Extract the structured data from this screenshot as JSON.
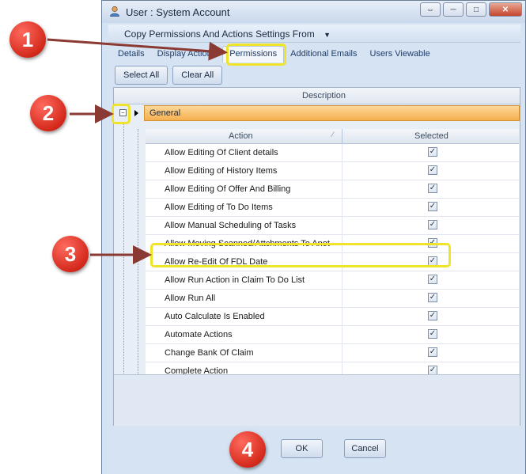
{
  "window": {
    "title": "User : System Account",
    "controls": {
      "restore": "⇔",
      "minimize": "─",
      "maximize": "□",
      "close": "✕"
    }
  },
  "copy_bar": {
    "label": "Copy Permissions And Actions Settings From",
    "icon": "chevron-down-icon"
  },
  "tabs": [
    "Details",
    "Display Actions",
    "Permissions",
    "Additional Emails",
    "Users Viewable"
  ],
  "active_tab": "Permissions",
  "buttons": {
    "select_all": "Select All",
    "clear_all": "Clear All"
  },
  "grid": {
    "header": "Description",
    "group": {
      "name": "General",
      "expander": "−"
    },
    "inner": {
      "col_action": "Action",
      "col_selected": "Selected",
      "rows": [
        {
          "label": "Allow Editing Of Client details",
          "checked": true
        },
        {
          "label": "Allow Editing of History Items",
          "checked": true
        },
        {
          "label": "Allow Editing Of Offer And Billing",
          "checked": true
        },
        {
          "label": "Allow Editing of To Do Items",
          "checked": true
        },
        {
          "label": "Allow Manual Scheduling of Tasks",
          "checked": true
        },
        {
          "label": "Allow Moving Scanned/Attchments To Anot",
          "checked": true
        },
        {
          "label": "Allow Re-Edit Of FDL Date",
          "checked": true
        },
        {
          "label": "Allow Run Action in Claim To Do List",
          "checked": true
        },
        {
          "label": "Allow Run All",
          "checked": true
        },
        {
          "label": "Auto Calculate Is Enabled",
          "checked": true
        },
        {
          "label": "Automate Actions",
          "checked": true
        },
        {
          "label": "Change Bank Of Claim",
          "checked": true
        },
        {
          "label": "Complete Action",
          "checked": true
        },
        {
          "label": "",
          "checked": true
        }
      ]
    }
  },
  "footer": {
    "ok": "OK",
    "cancel": "Cancel"
  },
  "callouts": [
    "1",
    "2",
    "3",
    "4"
  ],
  "colors": {
    "callout": "#d42a1c",
    "highlight": "#f0e42a",
    "group_bar": "#f6b04f",
    "arrow": "#8a3a33"
  }
}
